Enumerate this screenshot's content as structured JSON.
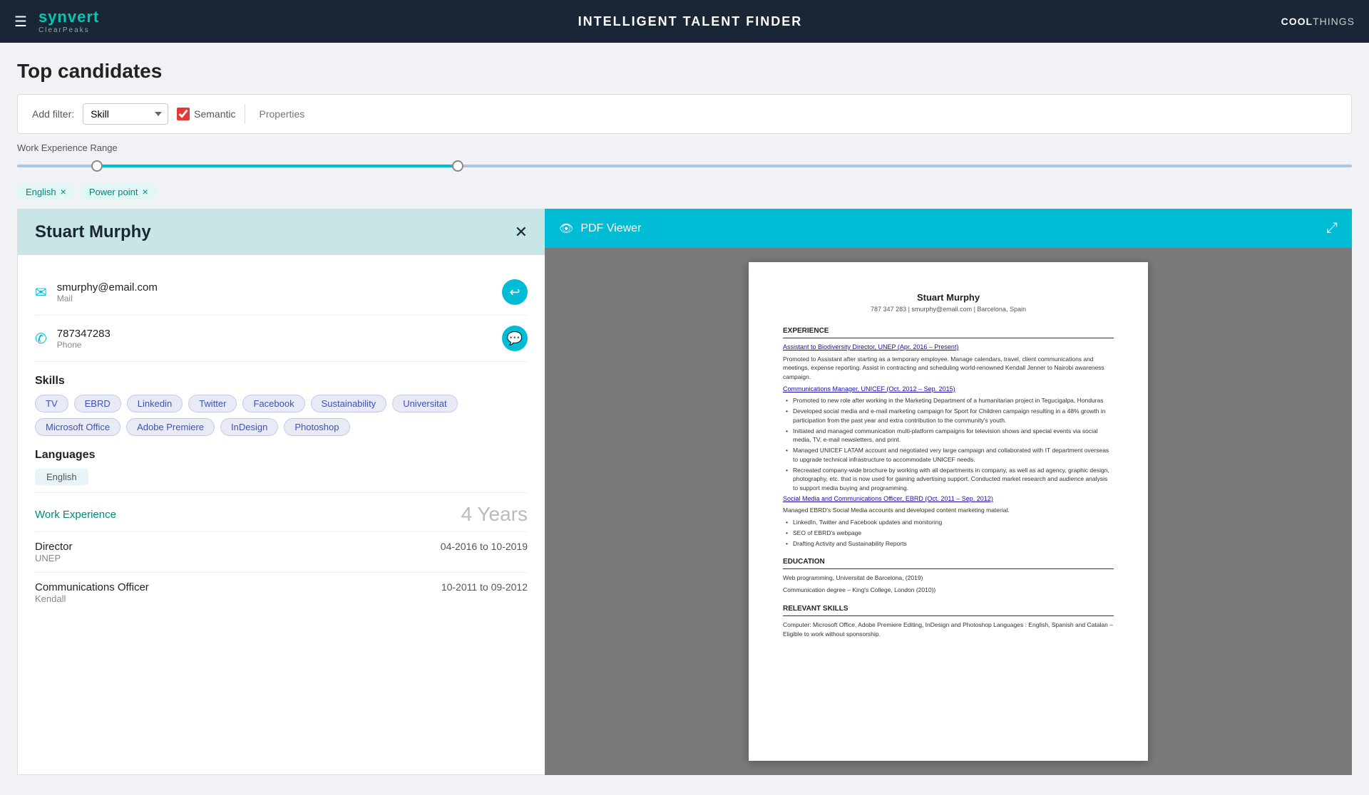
{
  "header": {
    "hamburger_icon": "☰",
    "logo_main": "synvert",
    "logo_sub": "ClearPeaks",
    "title": "INTELLIGENT TALENT FINDER",
    "brand_part1": "COOL",
    "brand_part2": "THINGS"
  },
  "page": {
    "title": "Top candidates"
  },
  "filter": {
    "add_filter_label": "Add filter:",
    "skill_option": "Skill",
    "semantic_label": "Semantic",
    "properties_placeholder": "Properties",
    "tags": [
      {
        "label": "English",
        "key": "english"
      },
      {
        "label": "Power point",
        "key": "powerpoint"
      }
    ]
  },
  "range": {
    "label": "Work Experience Range"
  },
  "candidate": {
    "name": "Stuart Murphy",
    "email": "smurphy@email.com",
    "email_label": "Mail",
    "phone": "787347283",
    "phone_label": "Phone",
    "skills_label": "Skills",
    "skills": [
      "TV",
      "EBRD",
      "Linkedin",
      "Twitter",
      "Facebook",
      "Sustainability",
      "Universitat",
      "Microsoft Office",
      "Adobe Premiere",
      "InDesign",
      "Photoshop"
    ],
    "languages_label": "Languages",
    "languages": [
      "English"
    ],
    "work_exp_label": "Work Experience",
    "work_exp_years": "4 Years",
    "jobs": [
      {
        "title": "Director",
        "org": "UNEP",
        "dates": "04-2016 to 10-2019"
      },
      {
        "title": "Communications Officer",
        "org": "Kendall",
        "dates": "10-2011 to 09-2012"
      }
    ]
  },
  "pdf_viewer": {
    "title": "PDF Viewer",
    "eye_icon": "👁",
    "expand_icon": "⤢",
    "resume": {
      "name": "Stuart Murphy",
      "contact": "787 347 283 | smurphy@email.com | Barcelona, Spain",
      "experience_title": "EXPERIENCE",
      "jobs": [
        {
          "title": "Assistant to Biodiversity Director, UNEP (Apr. 2016 – Present)",
          "body": "Promoted to Assistant after starting as a temporary employee. Manage calendars, travel, client communications and meetings, expense reporting. Assist in contracting and scheduling world-renowned Kendall Jenner to Nairobi awareness campaign."
        },
        {
          "title": "Communications Manager, UNICEF (Oct. 2012 – Sep. 2015)",
          "bullets": [
            "Promoted to new role after working in the Marketing Department of a humanitarian project in Tegucigalpa, Honduras",
            "Developed social media and e-mail marketing campaign for Sport for Children campaign resulting in a 48% growth in participation from the past year and extra contribution to the community's youth.",
            "Initiated and managed communication multi-platform campaigns for television shows and special events via social media, TV, e-mail newsletters, and print.",
            "Managed UNICEF LATAM account and negotiated very large campaign and collaborated with IT department overseas to upgrade technical infrastructure to accommodate UNICEF needs.",
            "Recreated company-wide brochure by working with all departments in company, as well as ad agency, graphic design, photography, etc. that is now used for gaining advertising support. Conducted market research and audience analysis to support media buying and programming."
          ]
        },
        {
          "title": "Social Media and Communications Officer, EBRD (Oct. 2011 – Sep. 2012)",
          "body": "Managed EBRD's Social Media accounts and developed content marketing material.",
          "bullets": [
            "LinkedIn, Twitter and Facebook updates and monitoring",
            "SEO of EBRD's webpage",
            "Drafting Activity and Sustainability Reports"
          ]
        }
      ],
      "education_title": "EDUCATION",
      "education": [
        "Web programming, Universitat de Barcelona, (2019)",
        "Communication degree – King's College, London (2010))"
      ],
      "relevant_skills_title": "RELEVANT SKILLS",
      "relevant_skills": "Computer: Microsoft Office, Adobe Premiere Editing, InDesign and Photoshop Languages : English, Spanish and Catalan – Eligible to work without sponsorship."
    }
  }
}
